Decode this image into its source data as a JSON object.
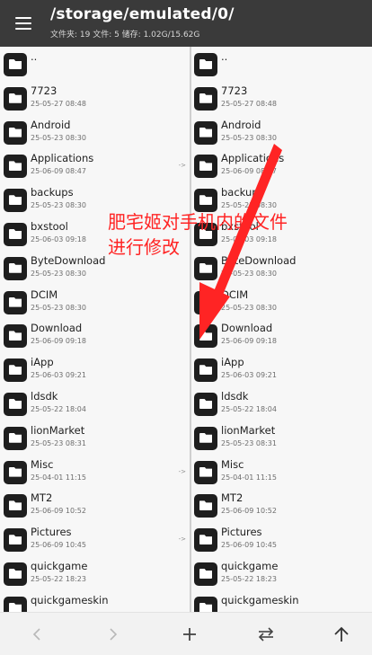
{
  "appbar": {
    "path": "/storage/emulated/0/",
    "stats": "文件夹: 19  文件: 5  储存: 1.02G/15.62G"
  },
  "left_pane": {
    "items": [
      {
        "name": "..",
        "date": "",
        "link": ""
      },
      {
        "name": "7723",
        "date": "25-05-27 08:48",
        "link": ""
      },
      {
        "name": "Android",
        "date": "25-05-23 08:30",
        "link": ""
      },
      {
        "name": "Applications",
        "date": "25-06-09 08:47",
        "link": "->"
      },
      {
        "name": "backups",
        "date": "25-05-23 08:30",
        "link": ""
      },
      {
        "name": "bxstool",
        "date": "25-06-03 09:18",
        "link": ""
      },
      {
        "name": "ByteDownload",
        "date": "25-05-23 08:30",
        "link": ""
      },
      {
        "name": "DCIM",
        "date": "25-05-23 08:30",
        "link": ""
      },
      {
        "name": "Download",
        "date": "25-06-09 09:18",
        "link": ""
      },
      {
        "name": "iApp",
        "date": "25-06-03 09:21",
        "link": ""
      },
      {
        "name": "ldsdk",
        "date": "25-05-22 18:04",
        "link": ""
      },
      {
        "name": "lionMarket",
        "date": "25-05-23 08:31",
        "link": ""
      },
      {
        "name": "Misc",
        "date": "25-04-01 11:15",
        "link": "->"
      },
      {
        "name": "MT2",
        "date": "25-06-09 10:52",
        "link": ""
      },
      {
        "name": "Pictures",
        "date": "25-06-09 10:45",
        "link": "->"
      },
      {
        "name": "quickgame",
        "date": "25-05-22 18:23",
        "link": ""
      },
      {
        "name": "quickgameskin",
        "date": "",
        "link": ""
      }
    ]
  },
  "right_pane": {
    "items": [
      {
        "name": "..",
        "date": "",
        "link": ""
      },
      {
        "name": "7723",
        "date": "25-05-27 08:48",
        "link": ""
      },
      {
        "name": "Android",
        "date": "25-05-23 08:30",
        "link": ""
      },
      {
        "name": "Applications",
        "date": "25-06-09 08:47",
        "link": ""
      },
      {
        "name": "backups",
        "date": "25-05-23 08:30",
        "link": ""
      },
      {
        "name": "bxstool",
        "date": "25-06-03 09:18",
        "link": ""
      },
      {
        "name": "ByteDownload",
        "date": "25-05-23 08:30",
        "link": ""
      },
      {
        "name": "DCIM",
        "date": "25-05-23 08:30",
        "link": ""
      },
      {
        "name": "Download",
        "date": "25-06-09 09:18",
        "link": ""
      },
      {
        "name": "iApp",
        "date": "25-06-03 09:21",
        "link": ""
      },
      {
        "name": "ldsdk",
        "date": "25-05-22 18:04",
        "link": ""
      },
      {
        "name": "lionMarket",
        "date": "25-05-23 08:31",
        "link": ""
      },
      {
        "name": "Misc",
        "date": "25-04-01 11:15",
        "link": ""
      },
      {
        "name": "MT2",
        "date": "25-06-09 10:52",
        "link": ""
      },
      {
        "name": "Pictures",
        "date": "25-06-09 10:45",
        "link": ""
      },
      {
        "name": "quickgame",
        "date": "25-05-22 18:23",
        "link": ""
      },
      {
        "name": "quickgameskin",
        "date": "",
        "link": ""
      }
    ]
  },
  "annotation": {
    "text": "肥宅姬对手机内的文件进行修改"
  },
  "bottombar": {
    "buttons": [
      "back-icon",
      "forward-icon",
      "add-icon",
      "swap-icon",
      "up-icon"
    ]
  },
  "colors": {
    "appbar": "#3a3a3a",
    "annotation": "#ff2424",
    "folder_icon": "#1e1e1e"
  }
}
